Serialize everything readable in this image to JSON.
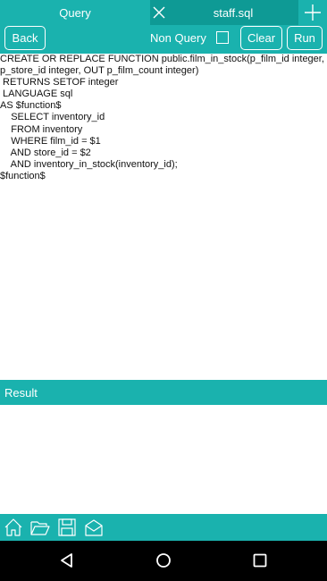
{
  "tabs": {
    "query_label": "Query",
    "file_label": "staff.sql"
  },
  "toolbar": {
    "back_label": "Back",
    "non_query_label": "Non Query",
    "clear_label": "Clear",
    "run_label": "Run"
  },
  "editor": {
    "lines": [
      "CREATE OR REPLACE FUNCTION public.film_in_stock(p_film_id integer,",
      "p_store_id integer, OUT p_film_count integer)",
      " RETURNS SETOF integer",
      " LANGUAGE sql",
      "AS $function$",
      "    SELECT inventory_id",
      "    FROM inventory",
      "    WHERE film_id = $1",
      "    AND store_id = $2",
      "    AND inventory_in_stock(inventory_id);",
      "$function$"
    ]
  },
  "result": {
    "header": "Result"
  },
  "colors": {
    "accent": "#1ab2ae",
    "accent_dark": "#0e9a95",
    "nav_bar": "#000000"
  },
  "icons": {
    "close_tab": "close-icon",
    "add_tab": "plus-icon",
    "home": "home-icon",
    "open": "folder-icon",
    "save": "save-icon",
    "mail": "mail-icon",
    "nav_back": "back-triangle-icon",
    "nav_home": "home-circle-icon",
    "nav_recents": "recents-square-icon"
  }
}
